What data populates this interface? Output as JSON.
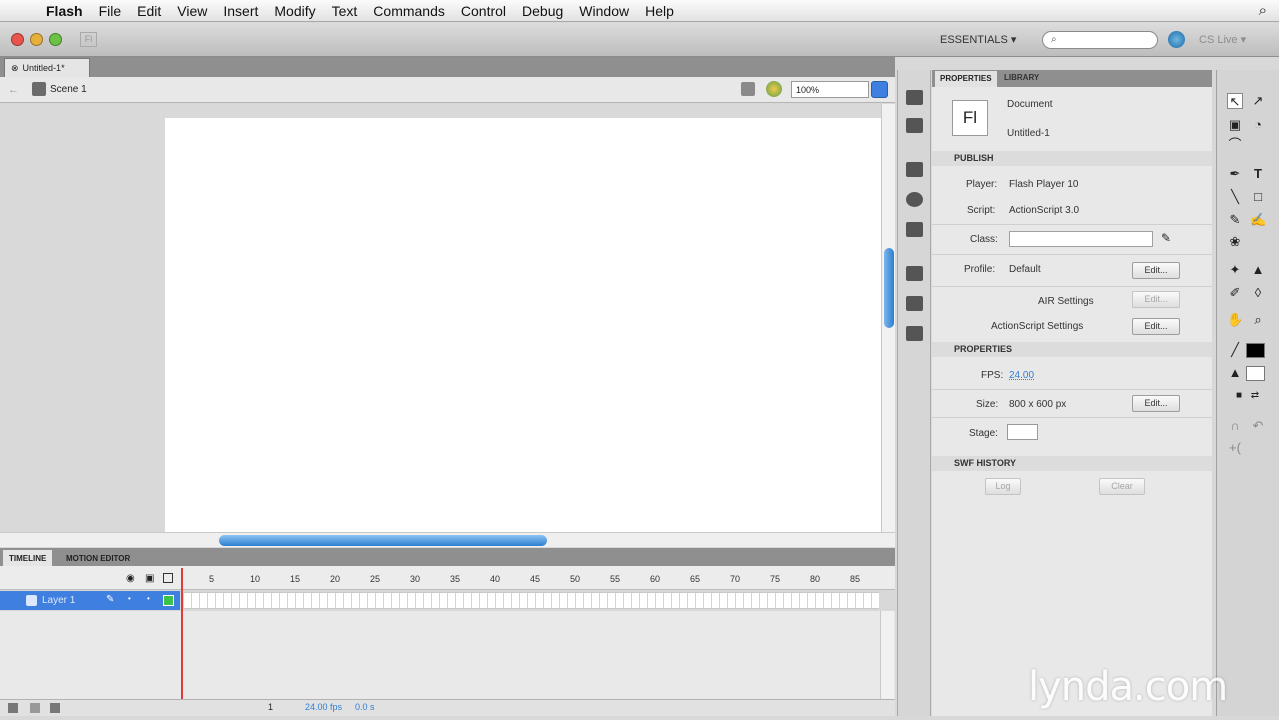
{
  "menubar": {
    "app": "Flash",
    "items": [
      "File",
      "Edit",
      "View",
      "Insert",
      "Modify",
      "Text",
      "Commands",
      "Control",
      "Debug",
      "Window",
      "Help"
    ]
  },
  "appbar": {
    "badge": "Fl",
    "workspace": "ESSENTIALS ▾",
    "search_placeholder": "",
    "cslive": "CS Live ▾"
  },
  "document": {
    "tab": "Untitled-1*",
    "scene": "Scene 1",
    "zoom": "100%"
  },
  "timeline": {
    "tabs": [
      "TIMELINE",
      "MOTION EDITOR"
    ],
    "frame_numbers": [
      "5",
      "10",
      "15",
      "20",
      "25",
      "30",
      "35",
      "40",
      "45",
      "50",
      "55",
      "60",
      "65",
      "70",
      "75",
      "80",
      "85"
    ],
    "layer_name": "Layer 1",
    "footer": {
      "current_frame": "1",
      "fps": "24.00 fps",
      "time": "0.0 s"
    }
  },
  "properties": {
    "tabs": [
      "PROPERTIES",
      "LIBRARY"
    ],
    "doc_icon": "Fl",
    "doc_type": "Document",
    "doc_name": "Untitled-1",
    "publish": {
      "header": "PUBLISH",
      "player_label": "Player:",
      "player_value": "Flash Player 10",
      "script_label": "Script:",
      "script_value": "ActionScript 3.0",
      "class_label": "Class:",
      "profile_label": "Profile:",
      "profile_value": "Default",
      "edit": "Edit...",
      "air_settings": "AIR Settings",
      "as_settings": "ActionScript Settings"
    },
    "props": {
      "header": "PROPERTIES",
      "fps_label": "FPS:",
      "fps_value": "24.00",
      "size_label": "Size:",
      "size_value": "800 x 600 px",
      "stage_label": "Stage:",
      "stage_color": "#ffffff"
    },
    "swf": {
      "header": "SWF HISTORY",
      "log": "Log",
      "clear": "Clear"
    }
  },
  "watermark": "lynda.com",
  "colors": {
    "selection_blue": "#3f7fe0",
    "playhead": "#e03a3a",
    "link_blue": "#2f7fd4"
  }
}
